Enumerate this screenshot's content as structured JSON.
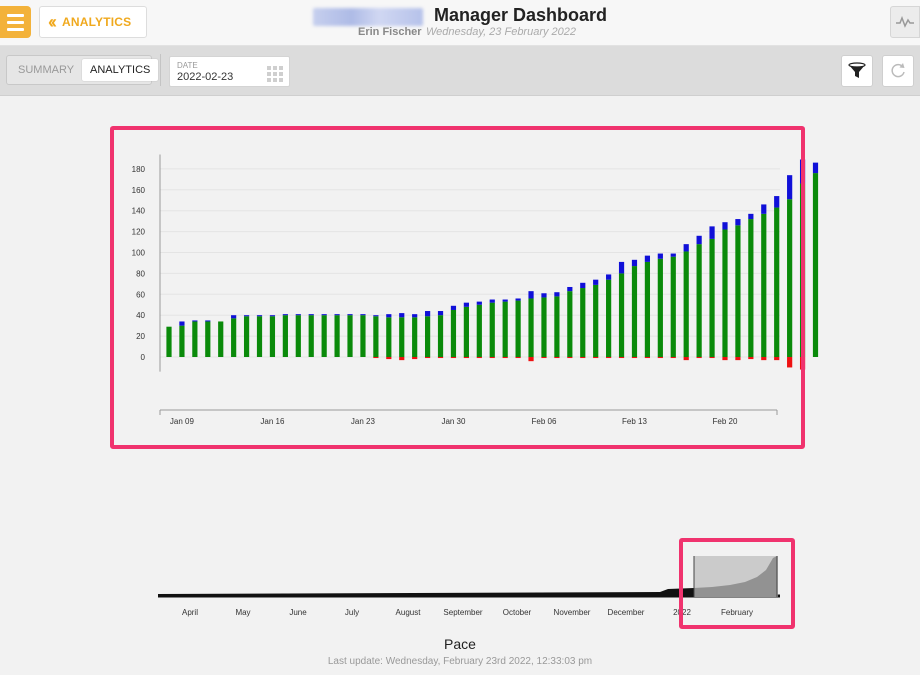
{
  "header": {
    "back_label": "ANALYTICS",
    "title": "Manager Dashboard",
    "user": "Erin Fischer",
    "date_sub": "Wednesday, 23 February 2022"
  },
  "toolbar": {
    "tabs": [
      {
        "label": "SUMMARY",
        "active": false
      },
      {
        "label": "ANALYTICS",
        "active": true
      }
    ],
    "date_label": "DATE",
    "date_value": "2022-02-23"
  },
  "icons": {
    "menu": "hamburger-icon",
    "back": "double-chevron-left-icon",
    "pulse": "activity-icon",
    "calendar": "calendar-grid-icon",
    "filter": "funnel-icon",
    "refresh": "refresh-icon"
  },
  "colors": {
    "accent": "#f3b23a",
    "green": "#0a8a0a",
    "blue": "#1010d8",
    "red": "#ee1111",
    "highlight": "#f0336e"
  },
  "chart_data": [
    {
      "type": "bar",
      "stacked": true,
      "ylim": [
        -10,
        190
      ],
      "yticks": [
        0,
        20,
        40,
        60,
        80,
        100,
        120,
        140,
        160,
        180
      ],
      "x_tick_labels": [
        "Jan 09",
        "Jan 16",
        "Jan 23",
        "Jan 30",
        "Feb 06",
        "Feb 13",
        "Feb 20"
      ],
      "x_tick_index": [
        1,
        8,
        15,
        22,
        29,
        36,
        43
      ],
      "series": [
        {
          "values": [
            29,
            30,
            34,
            34,
            34,
            37,
            39,
            39,
            39,
            40,
            40,
            40,
            40,
            40,
            40,
            40,
            39,
            38,
            38,
            38,
            39,
            40,
            45,
            48,
            50,
            52,
            53,
            54,
            56,
            57,
            58,
            63,
            66,
            69,
            74,
            80,
            87,
            91,
            94,
            96,
            101,
            108,
            113,
            122,
            126,
            132,
            137,
            143,
            151,
            166,
            176
          ]
        },
        {
          "values": [
            0,
            4,
            1,
            1,
            0,
            3,
            1,
            1,
            1,
            1,
            1,
            1,
            1,
            1,
            1,
            1,
            1,
            3,
            4,
            3,
            5,
            4,
            4,
            4,
            3,
            3,
            2,
            2,
            7,
            4,
            4,
            4,
            5,
            5,
            5,
            11,
            6,
            6,
            5,
            3,
            7,
            8,
            12,
            7,
            6,
            5,
            9,
            11,
            23,
            23,
            10
          ]
        },
        {
          "values": [
            0,
            0,
            0,
            0,
            0,
            0,
            0,
            0,
            0,
            0,
            0,
            0,
            0,
            0,
            0,
            0,
            -1,
            -2,
            -3,
            -2,
            -1,
            -1,
            -1,
            -1,
            -1,
            -1,
            -1,
            -1,
            -4,
            -1,
            -1,
            -1,
            -1,
            -1,
            -1,
            -1,
            -1,
            -1,
            -1,
            -1,
            -3,
            -1,
            -1,
            -3,
            -3,
            -2,
            -3,
            -3,
            -10,
            -12,
            0
          ]
        }
      ]
    },
    {
      "type": "area",
      "x_tick_labels": [
        "April",
        "May",
        "June",
        "July",
        "August",
        "September",
        "October",
        "November",
        "December",
        "2022",
        "February"
      ],
      "selection": "January – February 2022"
    }
  ],
  "footer": {
    "title": "Pace",
    "last_update": "Last update: Wednesday, February 23rd 2022, 12:33:03 pm"
  }
}
